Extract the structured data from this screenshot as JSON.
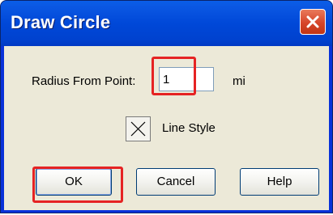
{
  "dialog": {
    "title": "Draw Circle"
  },
  "radius": {
    "label": "Radius From Point:",
    "value": "1",
    "unit": "mi"
  },
  "line_style": {
    "label": "Line Style",
    "icon": "x-icon"
  },
  "buttons": {
    "ok": "OK",
    "cancel": "Cancel",
    "help": "Help"
  },
  "colors": {
    "titlebar": "#0048d8",
    "client": "#ece9d8",
    "close_button": "#d6452a",
    "highlight": "#e52323"
  }
}
